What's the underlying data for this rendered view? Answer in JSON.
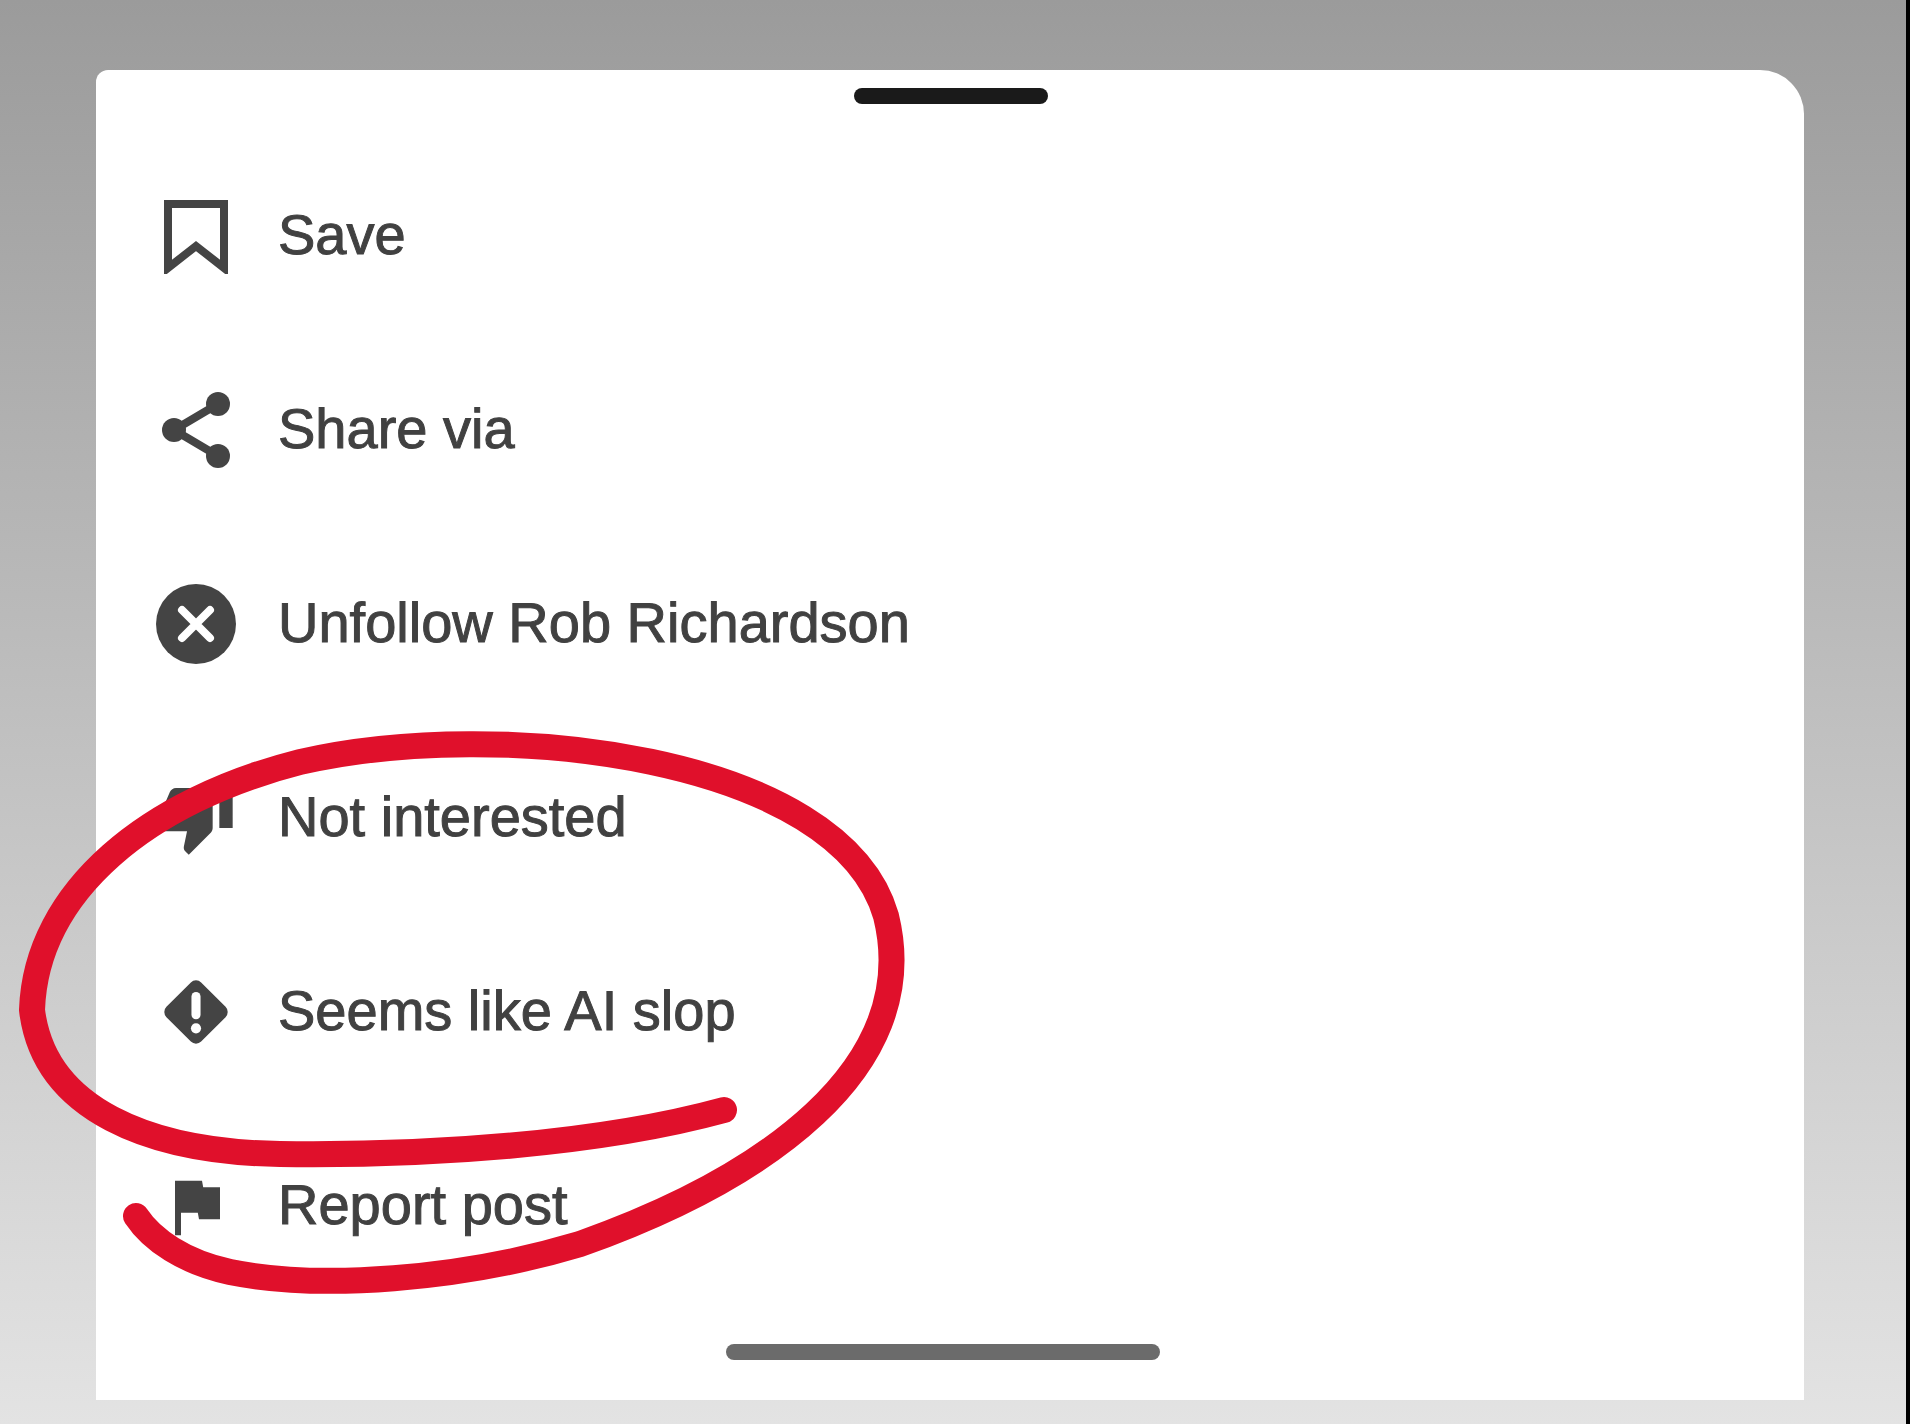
{
  "menu": {
    "items": [
      {
        "label": "Save"
      },
      {
        "label": "Share via"
      },
      {
        "label": "Unfollow Rob Richardson"
      },
      {
        "label": "Not interested"
      },
      {
        "label": "Seems like AI slop"
      },
      {
        "label": "Report post"
      }
    ]
  },
  "annotations": [
    {
      "kind": "freehand-loop"
    }
  ]
}
